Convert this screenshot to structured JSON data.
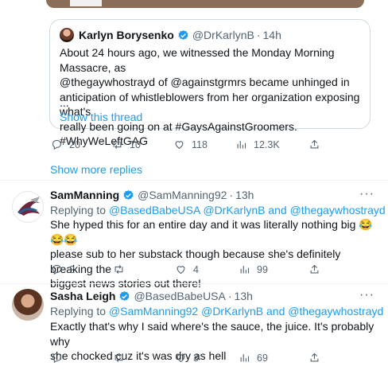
{
  "quoted": {
    "name": "Karlyn Borysenko",
    "handle": "@DrKarlynB",
    "time": "14h",
    "lines": [
      "About 24 hours ago, we witnessed the Monday Morning Massacre, as",
      "@thegaywhostrayd of @againstgrmrs became unhinged in",
      "anticipation of whistleblowers from her organization exposing what's",
      "really been going on at #GaysAgainstGroomers. #WhyWeLeftGAG"
    ],
    "more": "...",
    "show_thread": "Show this thread"
  },
  "main_stats": {
    "replies": "20",
    "retweets": "10",
    "likes": "118",
    "views": "12.3K"
  },
  "show_more_replies": "Show more replies",
  "replies": [
    {
      "name": "SamManning",
      "handle": "@SamManning92",
      "time": "13h",
      "replying_prefix": "Replying to",
      "replying_to": "@BasedBabeUSA @DrKarlynB and @thegaywhostrayd",
      "lines": [
        "She hyped this for an entire day and it was literally nothing big 😂😂😂",
        "please sub to her substack though because she's definitely breaking the",
        "biggest news stories out there!"
      ],
      "stats": {
        "replies": "2",
        "retweets": "",
        "likes": "4",
        "views": "99"
      }
    },
    {
      "name": "Sasha Leigh",
      "handle": "@BasedBabeUSA",
      "time": "13h",
      "replying_prefix": "Replying to",
      "replying_to": "@SamManning92 @DrKarlynB and @thegaywhostrayd",
      "lines": [
        "Exactly that's why I said where's the sauce, the juice. It's probably why",
        "she chocked cuz it's was dry as hell"
      ],
      "stats": {
        "replies": "",
        "retweets": "",
        "likes": "3",
        "views": "69"
      }
    }
  ],
  "separator": "·",
  "more_menu": "···",
  "colors": {
    "accent": "#1d9bf0",
    "muted": "#536471",
    "text": "#0f1419"
  }
}
